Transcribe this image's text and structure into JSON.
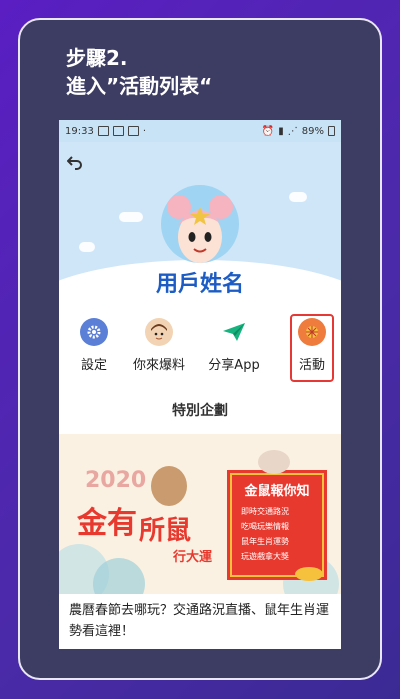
{
  "step": {
    "line1": "步驟2.",
    "line2": "進入”活動列表“"
  },
  "statusbar": {
    "time": "19:33",
    "battery": "89%"
  },
  "profile": {
    "username": "用戶姓名"
  },
  "menu": [
    {
      "label": "設定",
      "icon": "gear-icon",
      "color": "#5b7fd6"
    },
    {
      "label": "你來爆料",
      "icon": "reporter-avatar-icon",
      "color": "#f2d3b3"
    },
    {
      "label": "分享App",
      "icon": "paper-plane-icon",
      "color": "#17b37f"
    },
    {
      "label": "活動",
      "icon": "lantern-icon",
      "color": "#ef7b3d"
    }
  ],
  "section": {
    "title": "特別企劃"
  },
  "banner": {
    "year": "2020",
    "headline_a": "金有",
    "headline_b": "所鼠",
    "sub": "行大運",
    "sign_title": "金鼠報你知",
    "sign_items": [
      "即時交通路況",
      "吃喝玩樂情報",
      "鼠年生肖運勢",
      "玩遊戲拿大獎"
    ]
  },
  "article": {
    "caption": "農曆春節去哪玩？交通路況直播、鼠年生肖運勢看這裡！"
  },
  "colors": {
    "highlight": "#e53935",
    "username": "#1c5cc4"
  }
}
